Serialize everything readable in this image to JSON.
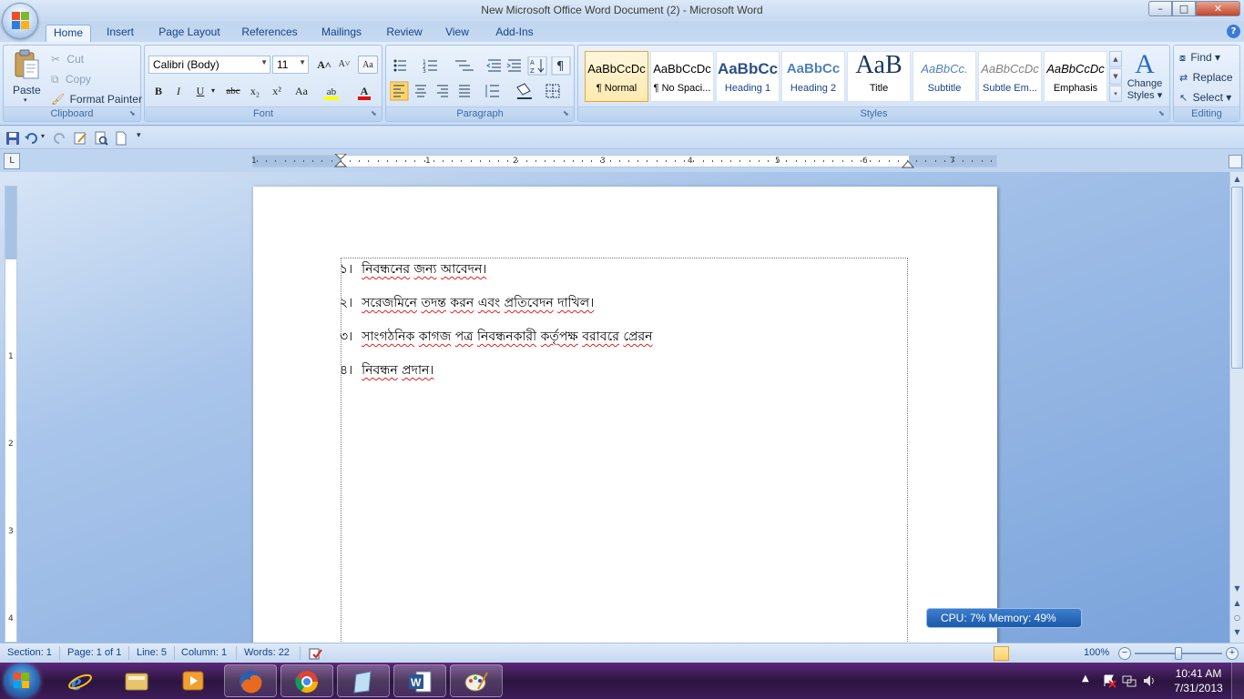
{
  "window": {
    "title": "New Microsoft Office Word Document (2) - Microsoft Word",
    "min": "–",
    "max": "□",
    "close": "✕"
  },
  "tabs": [
    {
      "label": "Home",
      "active": true
    },
    {
      "label": "Insert"
    },
    {
      "label": "Page Layout"
    },
    {
      "label": "References"
    },
    {
      "label": "Mailings"
    },
    {
      "label": "Review"
    },
    {
      "label": "View"
    },
    {
      "label": "Add-Ins"
    }
  ],
  "help": "?",
  "clipboard": {
    "label": "Clipboard",
    "paste": "Paste",
    "cut": "Cut",
    "copy": "Copy",
    "format_painter": "Format Painter"
  },
  "font": {
    "label": "Font",
    "family": "Calibri (Body)",
    "size": "11",
    "grow": "A˄",
    "shrink": "A˅",
    "clear": "Aa",
    "bold": "B",
    "italic": "I",
    "underline": "U",
    "strike": "abc",
    "subscript": "x₂",
    "superscript": "x²",
    "case": "Aa",
    "font_color": "A",
    "font_color_value": "#e01010",
    "highlight_color_value": "#ffff00"
  },
  "paragraph": {
    "label": "Paragraph",
    "show_marks": "¶"
  },
  "styles": {
    "label": "Styles",
    "items": [
      {
        "preview": "AaBbCcDc",
        "name": "¶ Normal",
        "selected": true
      },
      {
        "preview": "AaBbCcDc",
        "name": "¶ No Spaci..."
      },
      {
        "preview": "AaBbCc",
        "name": "Heading 1"
      },
      {
        "preview": "AaBbCc",
        "name": "Heading 2"
      },
      {
        "preview": "AaB",
        "name": "Title"
      },
      {
        "preview": "AaBbCc.",
        "name": "Subtitle"
      },
      {
        "preview": "AaBbCcDc",
        "name": "Subtle Em..."
      },
      {
        "preview": "AaBbCcDc",
        "name": "Emphasis"
      }
    ],
    "change_styles_line1": "Change",
    "change_styles_line2": "Styles ▾"
  },
  "editing": {
    "label": "Editing",
    "find": "Find ▾",
    "replace": "Replace",
    "select": "Select ▾"
  },
  "ruler": {
    "numbers": [
      "1",
      "1",
      "2",
      "3",
      "4",
      "5",
      "6",
      "7"
    ],
    "vnumbers": [
      "1",
      "2",
      "3",
      "4"
    ],
    "tab_selector": "L"
  },
  "document": {
    "lines": [
      {
        "num": "১।",
        "words": [
          "নিবন্ধনের",
          "জন্য",
          "আবেদন।"
        ]
      },
      {
        "num": "২।",
        "words": [
          "সরেজমিনে",
          "তদন্ত",
          "করন",
          "এবং",
          "প্রতিবেদন",
          "দাখিল।"
        ]
      },
      {
        "num": "৩।",
        "words": [
          "সাংগঠনিক",
          "কাগজ",
          "পত্র",
          "নিবন্ধনকারী",
          "কর্তৃপক্ষ",
          "বরাবরে",
          "প্রেরন"
        ]
      },
      {
        "num": "৪।",
        "words": [
          "নিবন্ধন",
          "প্রদান।"
        ]
      }
    ]
  },
  "cpu_widget": "CPU: 7%   Memory: 49%",
  "status": {
    "section": "Section: 1",
    "page": "Page: 1 of 1",
    "line": "Line: 5",
    "column": "Column: 1",
    "words": "Words: 22",
    "zoom": "100%",
    "zoom_minus": "−",
    "zoom_plus": "+",
    "zoom_fraction": 0.5
  },
  "taskbar": {
    "time": "10:41 AM",
    "date": "7/31/2013"
  },
  "colors": {
    "accent": "#15428b",
    "spell_underline": "#e02020"
  }
}
